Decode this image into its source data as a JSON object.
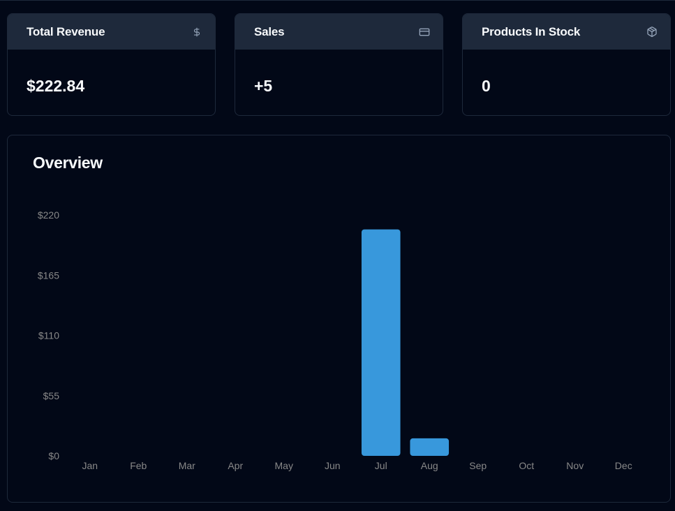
{
  "cards": [
    {
      "title": "Total Revenue",
      "value": "$222.84",
      "icon": "dollar-icon"
    },
    {
      "title": "Sales",
      "value": "+5",
      "icon": "credit-card-icon"
    },
    {
      "title": "Products In Stock",
      "value": "0",
      "icon": "package-icon"
    }
  ],
  "overview": {
    "title": "Overview"
  },
  "colors": {
    "background": "#020817",
    "card_header": "#1e293b",
    "bar": "#3898dc",
    "tick_text": "#888888"
  },
  "chart_data": {
    "type": "bar",
    "categories": [
      "Jan",
      "Feb",
      "Mar",
      "Apr",
      "May",
      "Jun",
      "Jul",
      "Aug",
      "Sep",
      "Oct",
      "Nov",
      "Dec"
    ],
    "values": [
      0,
      0,
      0,
      0,
      0,
      0,
      206.85,
      15.99,
      0,
      0,
      0,
      0
    ],
    "yticks": [
      "$0",
      "$55",
      "$110",
      "$165",
      "$220"
    ],
    "ylim": [
      0,
      220
    ],
    "grid": false,
    "legend": "none"
  }
}
